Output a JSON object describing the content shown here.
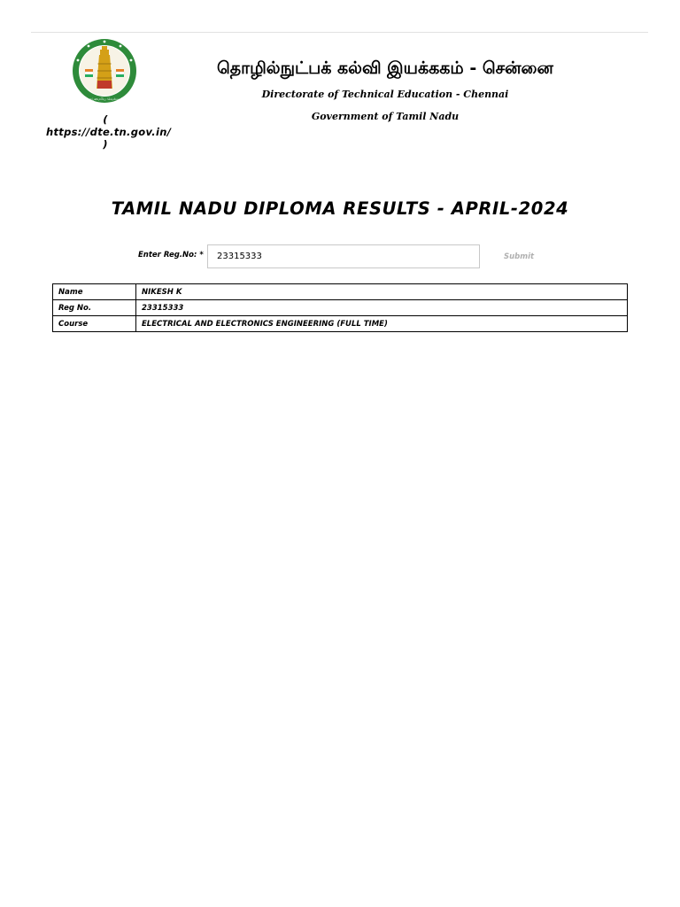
{
  "header": {
    "emblem": "tamil-nadu-government-emblem",
    "emblem_text": "வாய்மையே வெல்லும்",
    "website": "( https://dte.tn.gov.in/ )",
    "title_tamil": "தொழில்நுட்பக் கல்வி இயக்ககம் - சென்னை",
    "directorate": "Directorate of Technical Education - Chennai",
    "government": "Government of Tamil Nadu"
  },
  "main": {
    "title": "TAMIL NADU DIPLOMA RESULTS - APRIL-2024"
  },
  "form": {
    "reg_label": "Enter Reg.No: *",
    "reg_value": "23315333",
    "submit_label": "Submit"
  },
  "result": {
    "rows": [
      {
        "label": "Name",
        "value": "NIKESH K"
      },
      {
        "label": "Reg No.",
        "value": "23315333"
      },
      {
        "label": "Course",
        "value": "ELECTRICAL AND ELECTRONICS ENGINEERING (FULL TIME)"
      }
    ]
  },
  "colors": {
    "emblem_green": "#2e8b3a",
    "emblem_gold": "#d4a017",
    "emblem_red": "#c0392b",
    "border": "#c8c8c8",
    "submit_text": "#b0b0b0"
  }
}
